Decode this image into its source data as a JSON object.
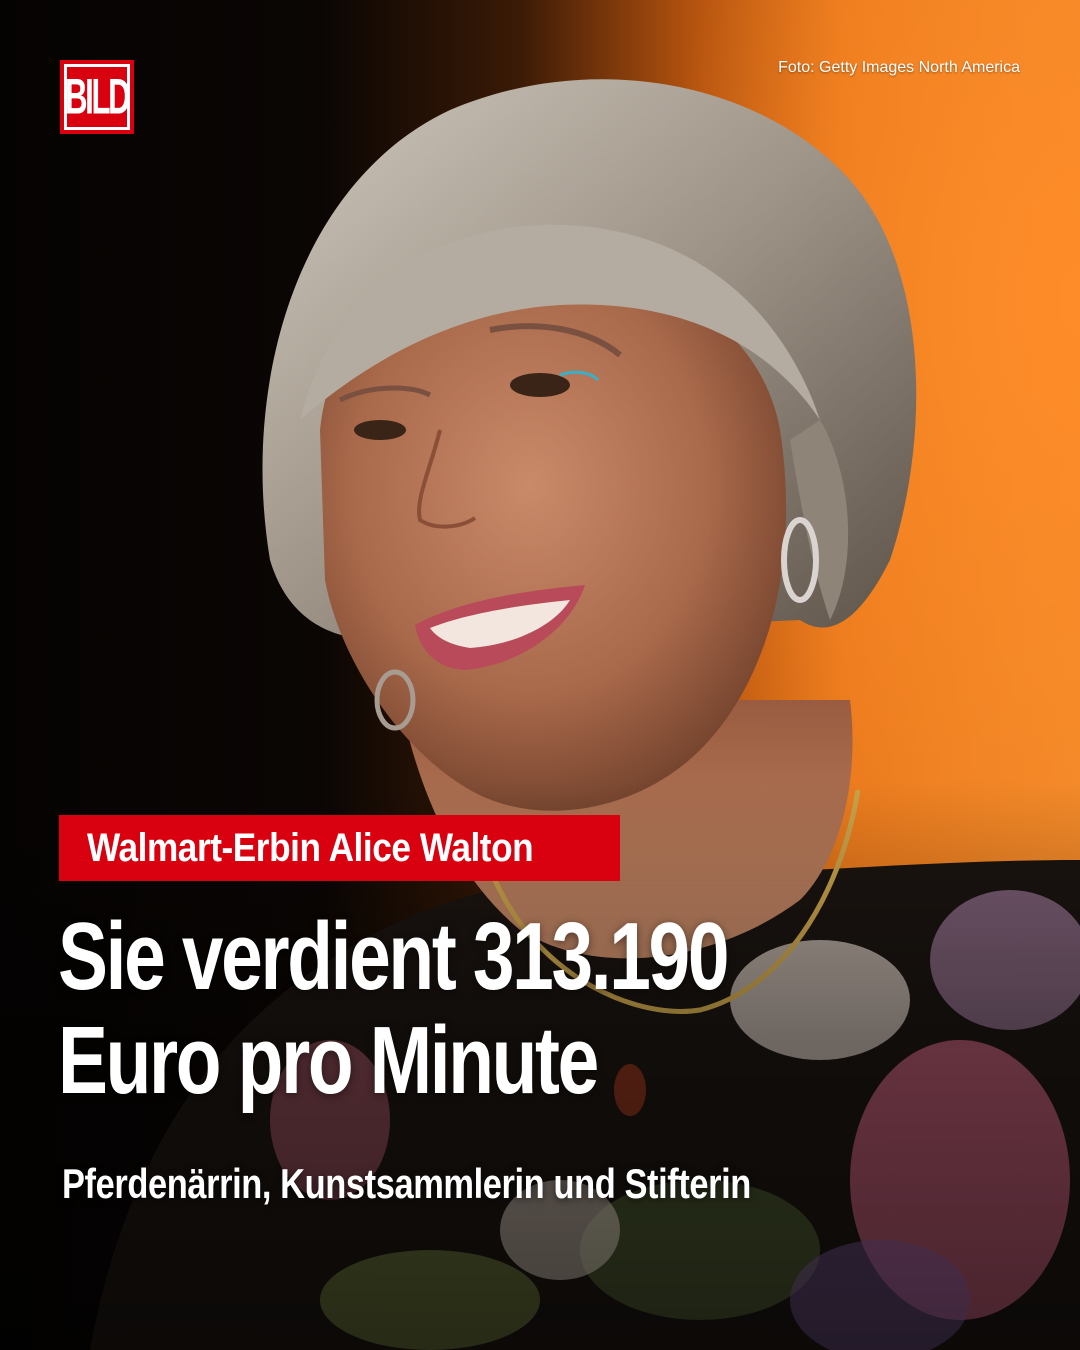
{
  "brand": {
    "logo_text": "BILD",
    "color": "#d9000f"
  },
  "photo_credit": "Foto:  Getty Images North America",
  "kicker": "Walmart-Erbin Alice Walton",
  "headline": {
    "line1": "Sie verdient 313.190",
    "line2": "Euro pro Minute"
  },
  "subline": "Pferdenärrin, Kunstsammlerin und Stifterin"
}
